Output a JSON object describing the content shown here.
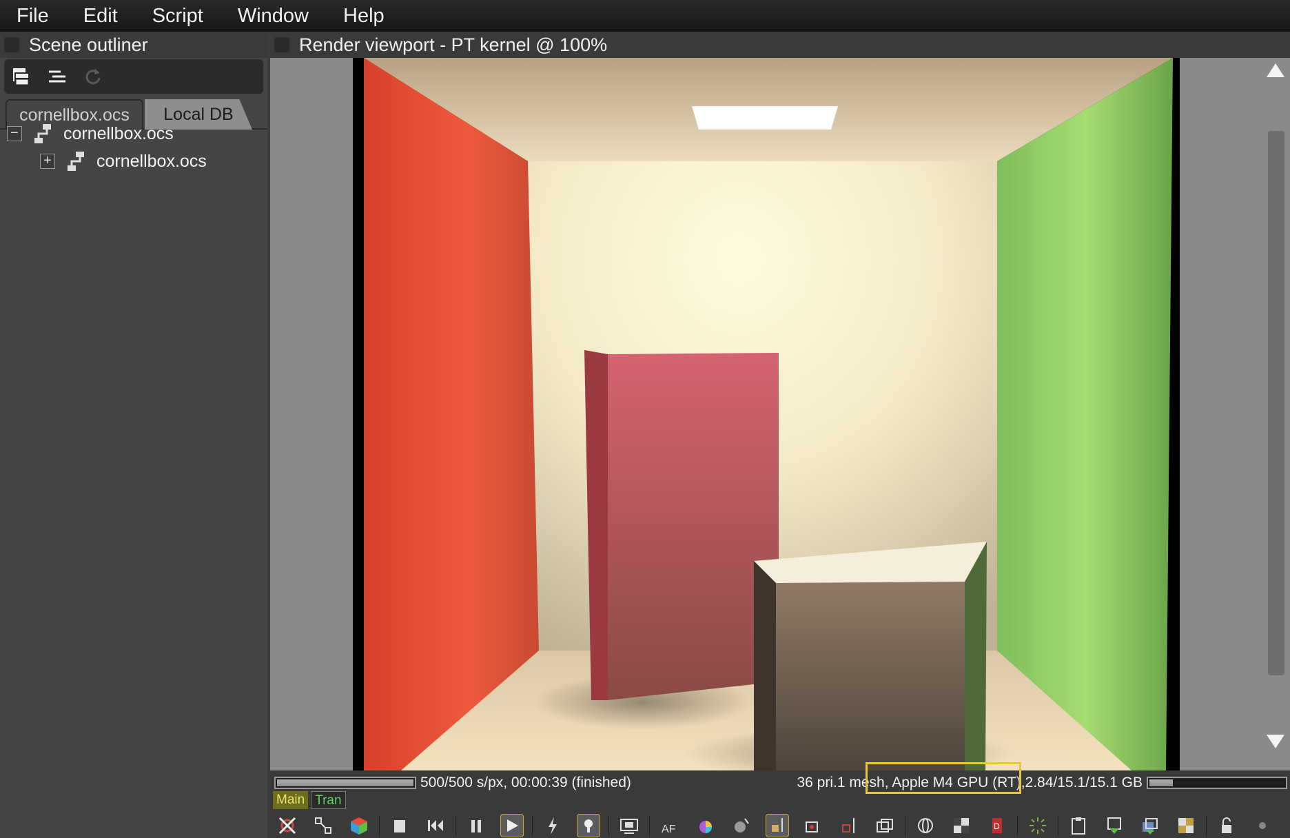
{
  "menubar": {
    "items": [
      "File",
      "Edit",
      "Script",
      "Window",
      "Help"
    ]
  },
  "outliner": {
    "title": "Scene outliner",
    "toolbar_icons": [
      "expand-all-icon",
      "collapse-all-icon",
      "refresh-icon"
    ],
    "tabs": [
      {
        "label": "cornellbox.ocs",
        "active": true
      },
      {
        "label": "Local DB",
        "active": false
      }
    ],
    "tree": [
      {
        "label": "cornellbox.ocs",
        "expander": "−",
        "depth": 0
      },
      {
        "label": "cornellbox.ocs",
        "expander": "+",
        "depth": 1
      }
    ]
  },
  "viewport": {
    "title": "Render viewport - PT kernel @ 100%",
    "status": {
      "samples": "500/500 s/px, 00:00:39 (finished)",
      "scene_info": "36 pri.1 mesh",
      "gpu_info": ", Apple M4 GPU (RT), ",
      "memory": "2.84/15.1/15.1 GB",
      "render_progress": 1.0,
      "memory_progress": 0.19
    },
    "modes": [
      {
        "label": "Main"
      },
      {
        "label": "Tran"
      }
    ],
    "toolbar_icons": [
      "recenter-view-icon",
      "reset-camera-icon",
      "object-mode-icon",
      "stop-icon",
      "restart-icon",
      "pause-icon",
      "start-icon",
      "lightning-icon",
      "light-bulb-icon",
      "region-render-icon",
      "autofocus-icon",
      "color-picker-icon",
      "material-picker-icon",
      "object-picker-icon",
      "camera-target-icon",
      "crop-region-icon",
      "film-region-icon",
      "world-icon",
      "clay-mode-icon",
      "subsample-icon",
      "decal-icon",
      "busy-icon",
      "copy-clipboard-icon",
      "save-render-icon",
      "export-passes-icon",
      "checker-icon",
      "lock-icon",
      "settings-dot-icon"
    ]
  }
}
